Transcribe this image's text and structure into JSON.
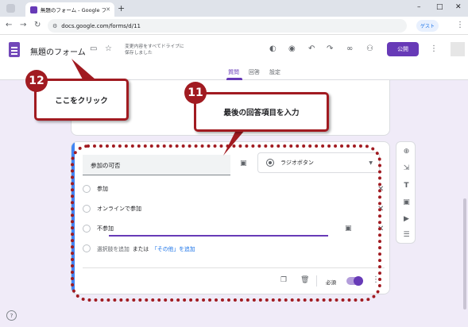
{
  "browser": {
    "tab_title": "無題のフォーム - Google フォーム",
    "tab_close": "✕",
    "new_tab": "+",
    "url": "docs.google.com/forms/d/11",
    "guest_label": "ゲスト",
    "win_min": "–",
    "win_max": "□",
    "win_close": "✕"
  },
  "forms_header": {
    "title": "無題のフォーム",
    "saved_line1": "変更内容をすべてドライブに",
    "saved_line2": "保存しました",
    "publish_label": "公開",
    "tabs": [
      "質問",
      "回答",
      "設定"
    ],
    "active_tab_index": 0
  },
  "question": {
    "title": "参加の可否",
    "type_label": "ラジオボタン",
    "options": [
      "参加",
      "オンラインで参加",
      "不参加"
    ],
    "add_option": "選択肢を追加",
    "or_text": "または",
    "add_other": "「その他」を追加",
    "required_label": "必須",
    "required_on": true
  },
  "annotations": {
    "step12_number": "12",
    "step12_text": "ここをクリック",
    "step11_number": "11",
    "step11_text": "最後の回答項目を入力",
    "color": "#a11b21"
  },
  "colors": {
    "accent": "#673ab7",
    "question_accent": "#4285f4",
    "background": "#f0ebf8"
  }
}
